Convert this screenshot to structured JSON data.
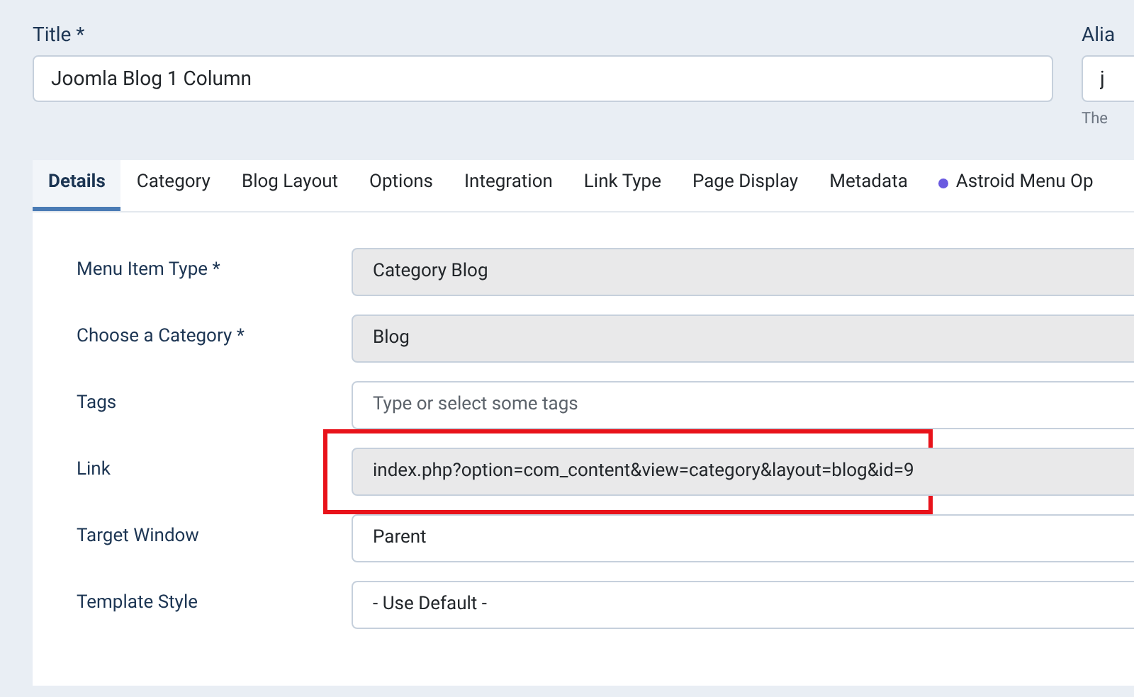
{
  "title_field": {
    "label": "Title *",
    "value": "Joomla Blog 1 Column"
  },
  "alias_field": {
    "label": "Alia",
    "value": "j",
    "hint": "The"
  },
  "tabs": [
    {
      "label": "Details",
      "selected": true,
      "kind": "plain"
    },
    {
      "label": "Category",
      "selected": false,
      "kind": "plain"
    },
    {
      "label": "Blog Layout",
      "selected": false,
      "kind": "plain"
    },
    {
      "label": "Options",
      "selected": false,
      "kind": "plain"
    },
    {
      "label": "Integration",
      "selected": false,
      "kind": "plain"
    },
    {
      "label": "Link Type",
      "selected": false,
      "kind": "plain"
    },
    {
      "label": "Page Display",
      "selected": false,
      "kind": "plain"
    },
    {
      "label": "Metadata",
      "selected": false,
      "kind": "plain"
    },
    {
      "label": "Astroid Menu Op",
      "selected": false,
      "kind": "dot"
    }
  ],
  "fields": [
    {
      "label": "Menu Item Type *",
      "value": "Category Blog",
      "kind": "readonly",
      "highlighted": false
    },
    {
      "label": "Choose a Category *",
      "value": "Blog",
      "kind": "readonly",
      "highlighted": false
    },
    {
      "label": "Tags",
      "placeholder": "Type or select some tags",
      "kind": "input",
      "highlighted": false
    },
    {
      "label": "Link",
      "value": "index.php?option=com_content&view=category&layout=blog&id=9",
      "kind": "readonly",
      "highlighted": true
    },
    {
      "label": "Target Window",
      "value": "Parent",
      "kind": "input",
      "highlighted": false
    },
    {
      "label": "Template Style",
      "value": "- Use Default -",
      "kind": "input",
      "highlighted": false
    }
  ]
}
